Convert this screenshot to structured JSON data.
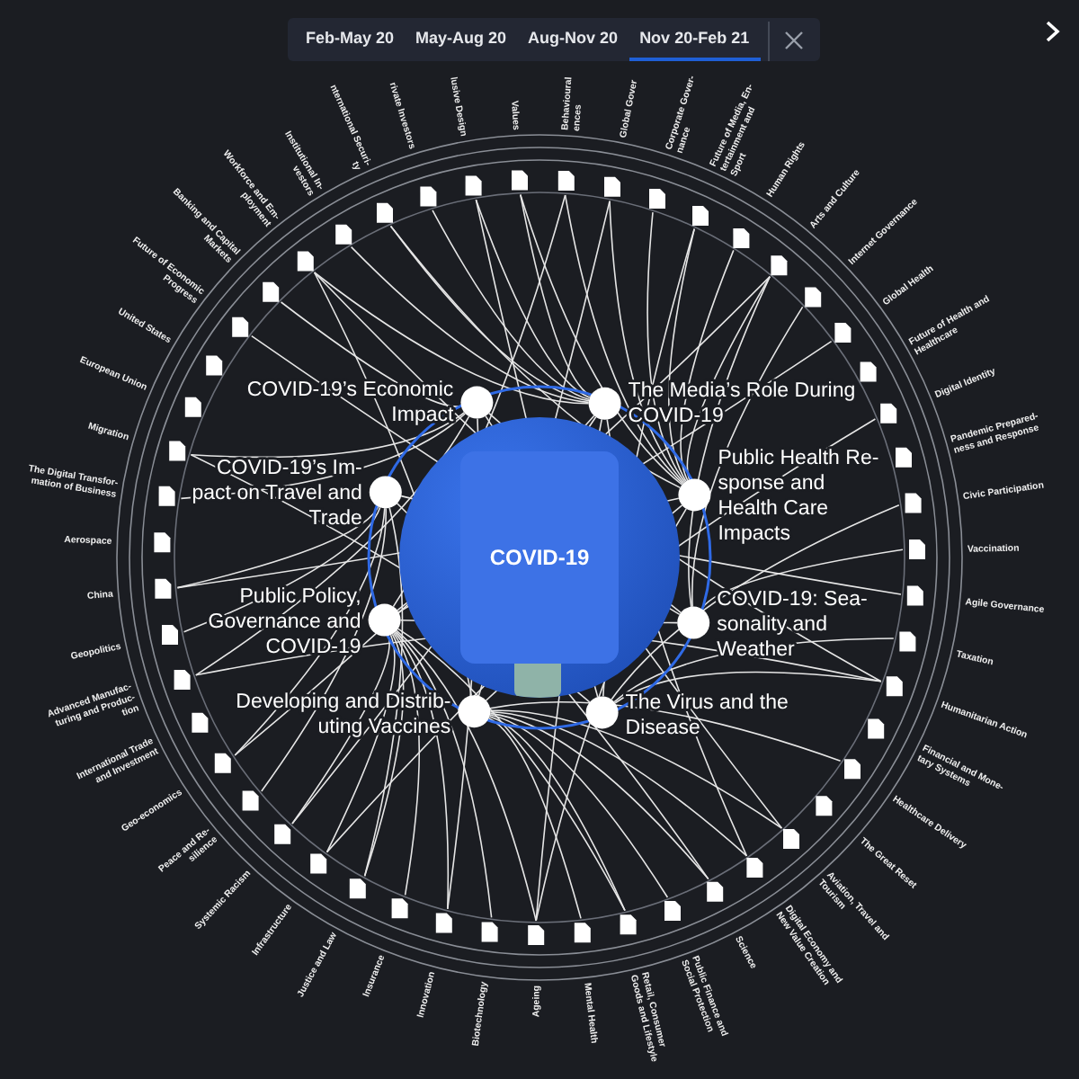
{
  "tabs": [
    {
      "label": "Feb-May 20",
      "selected": false
    },
    {
      "label": "May-Aug 20",
      "selected": false
    },
    {
      "label": "Aug-Nov 20",
      "selected": false
    },
    {
      "label": "Nov 20-Feb 21",
      "selected": true
    }
  ],
  "center": {
    "title": "COVID-19"
  },
  "topics": [
    {
      "lines": [
        "COVID-19’s Economic",
        "Impact"
      ]
    },
    {
      "lines": [
        "The Media’s Role During",
        "COVID-19"
      ]
    },
    {
      "lines": [
        "COVID-19’s Im-",
        "pact on Travel and",
        "Trade"
      ]
    },
    {
      "lines": [
        "Public Health Re-",
        "sponse and",
        "Health Care",
        "Impacts"
      ]
    },
    {
      "lines": [
        "Public Policy,",
        "Governance and",
        "COVID-19"
      ]
    },
    {
      "lines": [
        "COVID-19: Sea-",
        "sonality and",
        "Weather"
      ]
    },
    {
      "lines": [
        "Developing and Distrib-",
        "uting Vaccines"
      ]
    },
    {
      "lines": [
        "The Virus and the",
        "Disease"
      ]
    }
  ],
  "outer_topics": [
    {
      "lines": [
        "Values"
      ]
    },
    {
      "lines": [
        "Behavioural",
        "ences"
      ]
    },
    {
      "lines": [
        "Global Gover"
      ]
    },
    {
      "lines": [
        "Corporate Gover-",
        "nance"
      ]
    },
    {
      "lines": [
        "Future of Media, En-",
        "tertainment and",
        "Sport"
      ]
    },
    {
      "lines": [
        "Human Rights"
      ]
    },
    {
      "lines": [
        "Arts and Culture"
      ]
    },
    {
      "lines": [
        "Internet Governance"
      ]
    },
    {
      "lines": [
        "Global Health"
      ]
    },
    {
      "lines": [
        "Future of Health and",
        "Healthcare"
      ]
    },
    {
      "lines": [
        "Digital Identity"
      ]
    },
    {
      "lines": [
        "Pandemic Prepared-",
        "ness and Response"
      ]
    },
    {
      "lines": [
        "Civic Participation"
      ]
    },
    {
      "lines": [
        "Vaccination"
      ]
    },
    {
      "lines": [
        "Agile Governance"
      ]
    },
    {
      "lines": [
        "Taxation"
      ]
    },
    {
      "lines": [
        "Humanitarian Action"
      ]
    },
    {
      "lines": [
        "Financial and Mone-",
        "tary Systems"
      ]
    },
    {
      "lines": [
        "Healthcare Delivery"
      ]
    },
    {
      "lines": [
        "The Great Reset"
      ]
    },
    {
      "lines": [
        "Aviation, Travel and",
        "Tourism"
      ]
    },
    {
      "lines": [
        "Digital Economy and",
        "New Value Creation"
      ]
    },
    {
      "lines": [
        "Science"
      ]
    },
    {
      "lines": [
        "Public Finance and",
        "Social Protection"
      ]
    },
    {
      "lines": [
        "Retail, Consumer",
        "Goods and Lifestyle"
      ]
    },
    {
      "lines": [
        "Mental Health"
      ]
    },
    {
      "lines": [
        "Ageing"
      ]
    },
    {
      "lines": [
        "Biotechnology"
      ]
    },
    {
      "lines": [
        "Innovation"
      ]
    },
    {
      "lines": [
        "Insurance"
      ]
    },
    {
      "lines": [
        "Justice and Law"
      ]
    },
    {
      "lines": [
        "Infrastructure"
      ]
    },
    {
      "lines": [
        "Systemic Racism"
      ]
    },
    {
      "lines": [
        "Peace and Re-",
        "silience"
      ]
    },
    {
      "lines": [
        "Geo-economics"
      ]
    },
    {
      "lines": [
        "International Trade",
        "and Investment"
      ]
    },
    {
      "lines": [
        "Advanced Manufac-",
        "turing and Produc-",
        "tion"
      ]
    },
    {
      "lines": [
        "Geopolitics"
      ]
    },
    {
      "lines": [
        "China"
      ]
    },
    {
      "lines": [
        "Aerospace"
      ]
    },
    {
      "lines": [
        "The Digital Transfor-",
        "mation of Business"
      ]
    },
    {
      "lines": [
        "Migration"
      ]
    },
    {
      "lines": [
        "European Union"
      ]
    },
    {
      "lines": [
        "United States"
      ]
    },
    {
      "lines": [
        "Future of Economic",
        "Progress"
      ]
    },
    {
      "lines": [
        "Banking and Capital",
        "Markets"
      ]
    },
    {
      "lines": [
        "Workforce and Em-",
        "ployment"
      ]
    },
    {
      "lines": [
        "Institutional In-",
        "vestors"
      ]
    },
    {
      "lines": [
        "nternational Securi-",
        "ty"
      ]
    },
    {
      "lines": [
        "rivate Investors"
      ]
    },
    {
      "lines": [
        "lusive Design"
      ]
    }
  ]
}
